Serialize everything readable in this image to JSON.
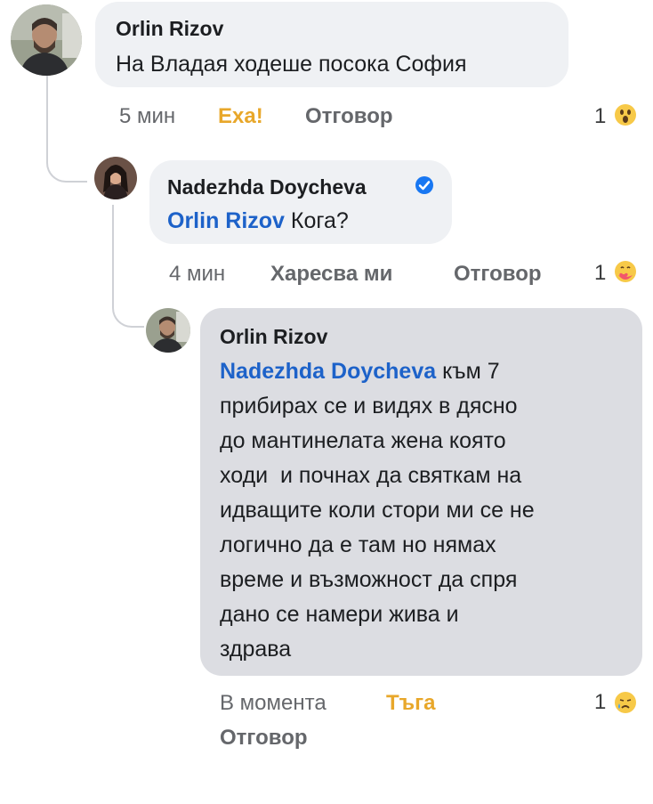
{
  "comments": [
    {
      "author": "Orlin Rizov",
      "text": "На Владая ходеше посока София",
      "time": "5 мин",
      "reaction_label": "Еха!",
      "reply_label": "Отговор",
      "reaction_count": "1",
      "reaction_icon": "wow-emoji-icon"
    },
    {
      "author": "Nadezhda Doycheva",
      "verified": true,
      "mention": "Orlin Rizov",
      "text": " Кога?",
      "time": "4 мин",
      "reaction_label": "Харесва ми",
      "reply_label": "Отговор",
      "reaction_count": "1",
      "reaction_icon": "care-emoji-icon"
    },
    {
      "author": "Orlin Rizov",
      "mention": "Nadezhda Doycheva",
      "lines": [
        " към 7",
        "прибирах се и видях в дясно",
        "до мантинелата жена която",
        "ходи  и почнах да святкам на",
        "идващите коли стори ми се не",
        "логично да е там но нямах",
        "време и възможност да спря",
        "дано се намери жива и",
        "здрава"
      ],
      "time": "В момента",
      "reaction_label": "Тъга",
      "reply_label": "Отговор",
      "reaction_count": "1",
      "reaction_icon": "sad-emoji-icon"
    }
  ],
  "colors": {
    "bubble": "#eff1f4",
    "selected_bubble": "#dcdde2",
    "mention": "#1d62c9",
    "reaction_active": "#e8a72a",
    "meta": "#65676b",
    "verified": "#1877f2"
  }
}
